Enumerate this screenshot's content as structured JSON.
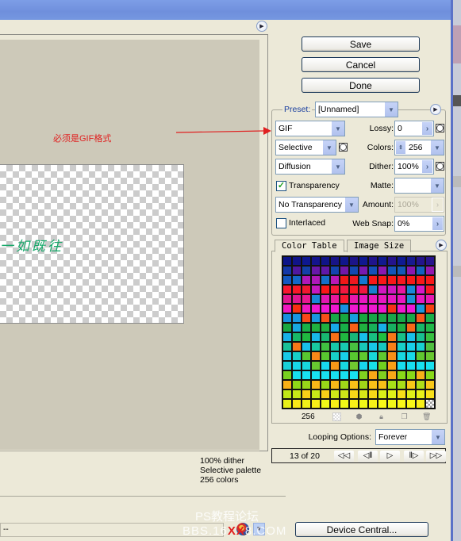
{
  "window": {
    "title": ""
  },
  "preview": {
    "annotation": "必须是GIF格式",
    "image_text": "一如既往",
    "status_lines": [
      "100% dither",
      "Selective palette",
      "256 colors"
    ]
  },
  "bottom": {
    "zoom_value": "--",
    "device_central_label": "Device Central...",
    "watermark_line1": "PS教程论坛",
    "watermark_line2_pre": "BBS.16",
    "watermark_line2_x": "XX",
    "watermark_line2_post": "8.COM"
  },
  "buttons": {
    "save": "Save",
    "cancel": "Cancel",
    "done": "Done"
  },
  "settings": {
    "preset_label": "Preset:",
    "preset_value": "[Unnamed]",
    "format_value": "GIF",
    "lossy_label": "Lossy:",
    "lossy_value": "0",
    "reduction_value": "Selective",
    "colors_label": "Colors:",
    "colors_value": "256",
    "dither_algo_value": "Diffusion",
    "dither_label": "Dither:",
    "dither_value": "100%",
    "transparency_label": "Transparency",
    "transparency_checked": true,
    "matte_label": "Matte:",
    "matte_value": "",
    "transparency_dither_value": "No Transparency ..",
    "amount_label": "Amount:",
    "amount_value": "100%",
    "interlaced_label": "Interlaced",
    "interlaced_checked": false,
    "websnap_label": "Web Snap:",
    "websnap_value": "0%"
  },
  "tabs": [
    {
      "label": "Color Table",
      "active": true
    },
    {
      "label": "Image Size",
      "active": false
    }
  ],
  "color_table": {
    "count": "256",
    "columns": 16,
    "colors": [
      "#0c1488",
      "#101488",
      "#0e1890",
      "#14148c",
      "#101488",
      "#181488",
      "#10168c",
      "#1c1488",
      "#101890",
      "#20148c",
      "#101a90",
      "#24148c",
      "#101a92",
      "#181a90",
      "#24148c",
      "#28148c",
      "#1438a8",
      "#5018a0",
      "#1440a8",
      "#6818a8",
      "#6018a8",
      "#1444b0",
      "#7018a8",
      "#1448b0",
      "#7818b0",
      "#1450b8",
      "#8818b0",
      "#1454b8",
      "#1458b8",
      "#8a18b0",
      "#1460c0",
      "#9418b0",
      "#1458c0",
      "#1468c8",
      "#b018b8",
      "#b018b8",
      "#1470c8",
      "#b818b8",
      "#f01818",
      "#f01820",
      "#1478d0",
      "#f81818",
      "#f81818",
      "#f81818",
      "#f81820",
      "#f81818",
      "#f81818",
      "#f81818",
      "#f81830",
      "#f81828",
      "#f01830",
      "#c818c0",
      "#f81818",
      "#f81838",
      "#f01840",
      "#f81828",
      "#f01840",
      "#1880d0",
      "#d018c0",
      "#d018c0",
      "#e818a0",
      "#1888d8",
      "#d818c8",
      "#f81828",
      "#e01890",
      "#e01890",
      "#e81890",
      "#1888d8",
      "#e018b0",
      "#e818a0",
      "#f81830",
      "#e818b0",
      "#e818c0",
      "#e818c0",
      "#e818c0",
      "#e818c0",
      "#e818c0",
      "#1890d8",
      "#e818c0",
      "#e818b0",
      "#f018c0",
      "#f83010",
      "#f018c0",
      "#f018d0",
      "#f018d0",
      "#f018d0",
      "#1890e0",
      "#f018d0",
      "#f018d0",
      "#f018d0",
      "#f018d0",
      "#f83018",
      "#f018d0",
      "#f018d8",
      "#1898e0",
      "#f84010",
      "#1890e0",
      "#1898e0",
      "#f84818",
      "#1898e0",
      "#f85018",
      "#18a848",
      "#18a840",
      "#18a0e0",
      "#18a840",
      "#18a848",
      "#18a848",
      "#18a848",
      "#18a848",
      "#18a848",
      "#f85818",
      "#18b048",
      "#18a840",
      "#18a8e0",
      "#18b048",
      "#20b040",
      "#20b040",
      "#18a8e8",
      "#18b048",
      "#f86018",
      "#20b040",
      "#18b058",
      "#18b0e8",
      "#18b060",
      "#20b040",
      "#f86818",
      "#18b868",
      "#20b848",
      "#18b0e8",
      "#18b868",
      "#20b840",
      "#18b8e8",
      "#18b870",
      "#f87018",
      "#20b840",
      "#18b878",
      "#18c0e8",
      "#18c080",
      "#20c040",
      "#f87818",
      "#18c088",
      "#18c0e8",
      "#18c090",
      "#38c040",
      "#18c098",
      "#f87818",
      "#18c0e8",
      "#18c8a0",
      "#40c040",
      "#18c8a8",
      "#18c8b0",
      "#48c040",
      "#18c8b8",
      "#18c8e8",
      "#18c8c0",
      "#f88018",
      "#18d0c8",
      "#18d0e8",
      "#18d0d0",
      "#50c040",
      "#18c8e8",
      "#18d0c8",
      "#58c830",
      "#f88818",
      "#58c830",
      "#18d0c8",
      "#18d0e8",
      "#58c830",
      "#60c830",
      "#18d8d8",
      "#60c830",
      "#f89018",
      "#18d8e0",
      "#18d8e8",
      "#60c830",
      "#68c830",
      "#18d0d8",
      "#18d8e8",
      "#18d8e0",
      "#68c830",
      "#18d8f0",
      "#f89818",
      "#18d8e0",
      "#70c830",
      "#18d8f0",
      "#18e0e8",
      "#70d020",
      "#f8a018",
      "#18e0f0",
      "#18e0f0",
      "#18e0f0",
      "#18e0f0",
      "#78d020",
      "#18e0f0",
      "#18e0f0",
      "#18e0f0",
      "#18e0f0",
      "#18e0f0",
      "#18e0f0",
      "#18e0f0",
      "#80d020",
      "#f8a818",
      "#80d020",
      "#f8a818",
      "#88d818",
      "#88d818",
      "#f8b018",
      "#88d818",
      "#f8b018",
      "#90d818",
      "#98d818",
      "#f8b818",
      "#98d818",
      "#f8b818",
      "#a0d818",
      "#f8c018",
      "#a0d818",
      "#f8c018",
      "#f8c018",
      "#a8e018",
      "#a8e018",
      "#f8c818",
      "#b0e018",
      "#f8c818",
      "#c0e818",
      "#c8e818",
      "#f8d018",
      "#c8e818",
      "#f8d018",
      "#d0e818",
      "#d0e818",
      "#f8d818",
      "#d8e818",
      "#f8d818",
      "#d8f018",
      "#e0f018",
      "#f8e018",
      "#e0f018",
      "#e8f018",
      "#f8e018",
      "#e8f018",
      "#f8e818",
      "#f0f018",
      "#f8f018",
      "#f0f818",
      "#f8f018",
      "#f0f818",
      "#f8f018",
      "#f0f818",
      "#f8f018",
      "#f8f818",
      "#f0f818",
      "#f8f818",
      "#f8f818",
      "#f8f018",
      "transparent"
    ]
  },
  "looping": {
    "label": "Looping Options:",
    "value": "Forever"
  },
  "animation": {
    "frame_text": "13 of 20",
    "current_frame": 13,
    "total_frames": 20,
    "buttons": [
      "first-frame",
      "previous-frame",
      "play",
      "next-frame",
      "last-frame"
    ]
  }
}
